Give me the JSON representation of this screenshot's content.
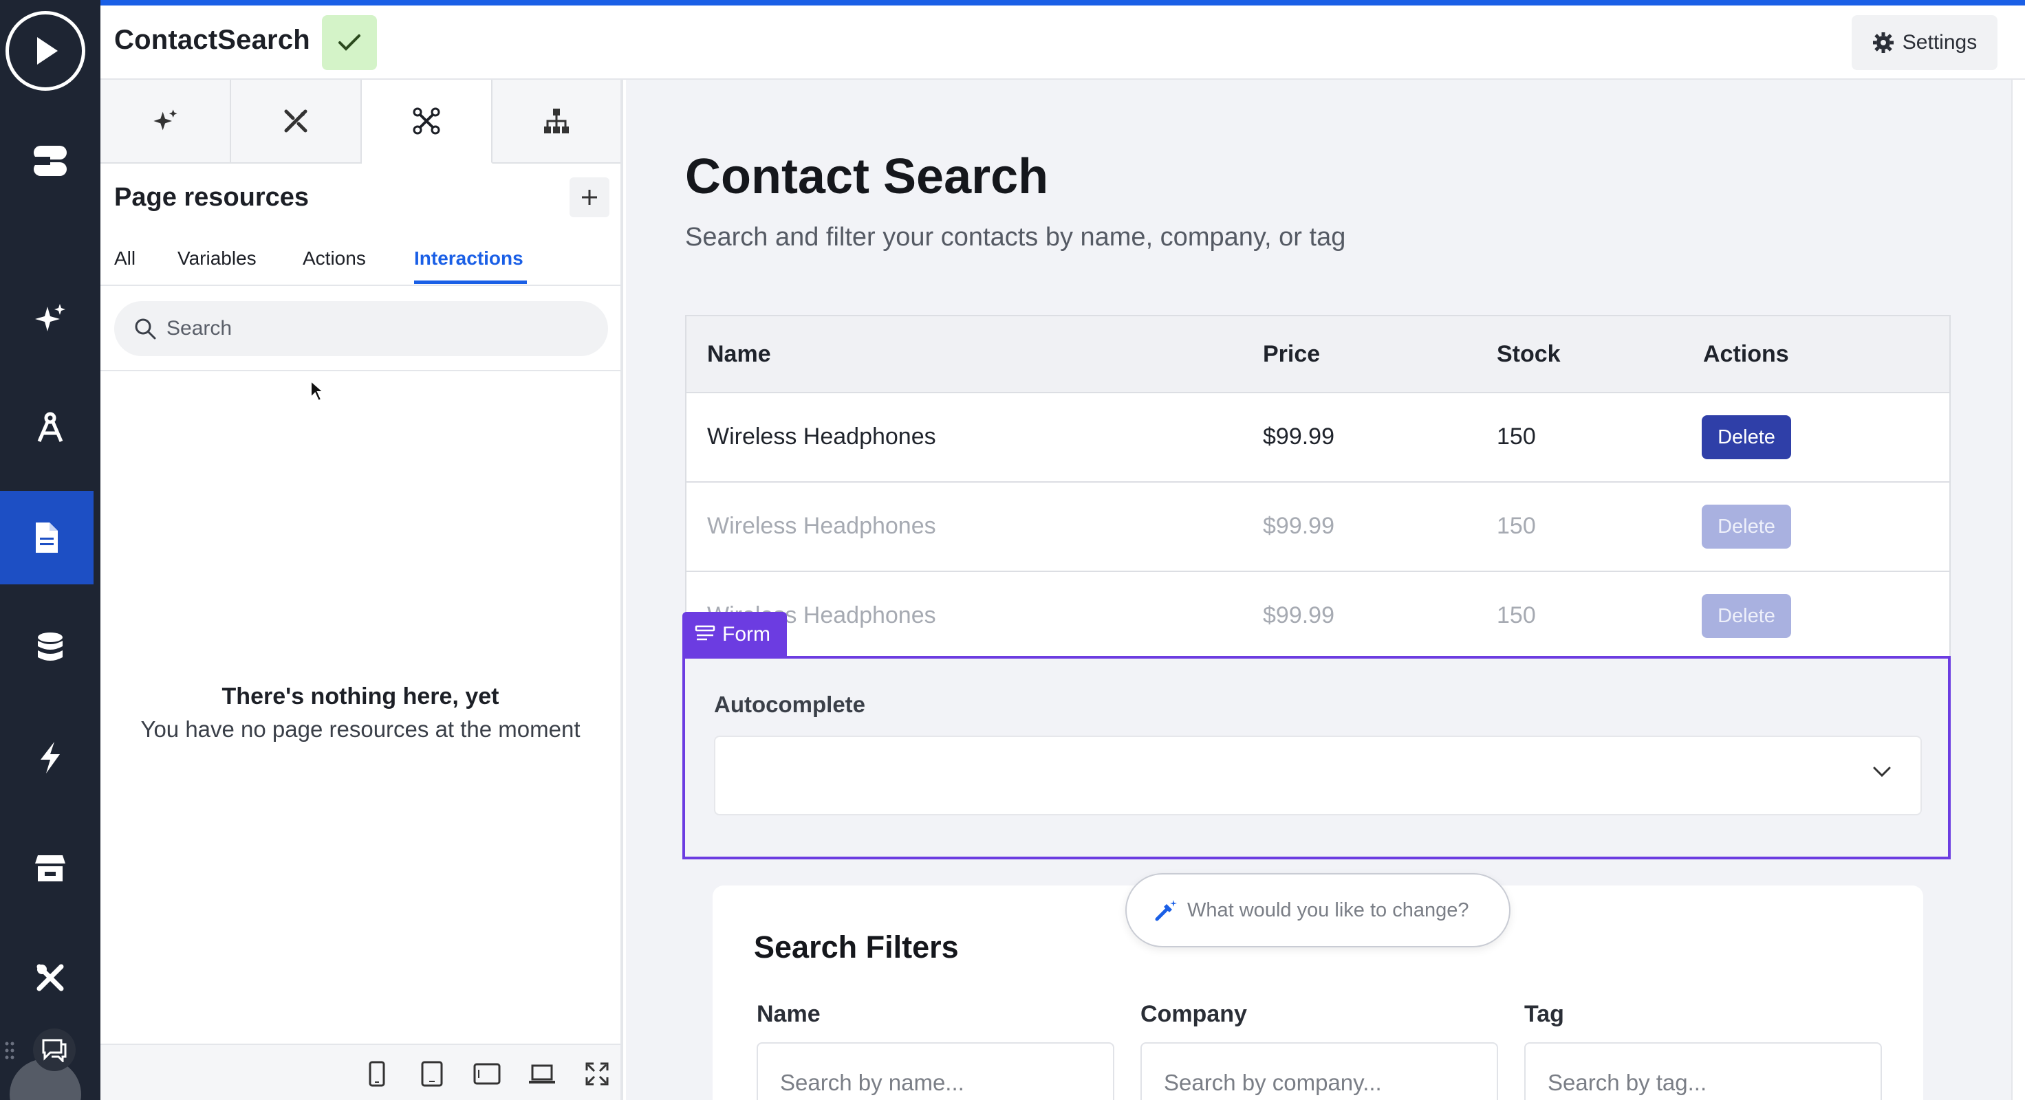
{
  "app": {
    "title": "ContactSearch",
    "settings_label": "Settings"
  },
  "colors": {
    "accent": "#1a5fe6",
    "rail_bg": "#1e2533",
    "rail_active": "#1d4fc4",
    "form_outline": "#6c3ce1",
    "delete_btn": "#2f3fa8",
    "status_green": "#d4f3c8"
  },
  "rail": {
    "items": [
      "play-icon",
      "storage-icon",
      "sparkle-icon",
      "compass-icon",
      "page-icon",
      "database-icon",
      "bolt-icon",
      "store-icon",
      "tools-icon",
      "chat-icon"
    ],
    "active": "page-icon"
  },
  "panel": {
    "tabs": [
      "sparkle-icon",
      "magic-tools-icon",
      "interactions-icon",
      "sitemap-icon"
    ],
    "active_tab": "interactions-icon",
    "title": "Page resources",
    "filter_tabs": [
      "All",
      "Variables",
      "Actions",
      "Interactions"
    ],
    "active_filter": "Interactions",
    "search_placeholder": "Search",
    "empty_title": "There's nothing here, yet",
    "empty_subtitle": "You have no page resources at the moment",
    "device_icons": [
      "phone-icon",
      "tablet-icon",
      "tablet-landscape-icon",
      "laptop-icon",
      "fullscreen-icon"
    ]
  },
  "page": {
    "heading": "Contact Search",
    "subheading": "Search and filter your contacts by name, company, or tag",
    "table": {
      "columns": [
        "Name",
        "Price",
        "Stock",
        "Actions"
      ],
      "rows": [
        {
          "name": "Wireless Headphones",
          "price": "$99.99",
          "stock": "150",
          "action": "Delete",
          "dimmed": false
        },
        {
          "name": "Wireless Headphones",
          "price": "$99.99",
          "stock": "150",
          "action": "Delete",
          "dimmed": true
        },
        {
          "name": "Wireless Headphones",
          "price": "$99.99",
          "stock": "150",
          "action": "Delete",
          "dimmed": true
        }
      ]
    },
    "form_tag": "Form",
    "autocomplete_label": "Autocomplete",
    "ai_prompt_placeholder": "What would you like to change?",
    "filters": {
      "title": "Search Filters",
      "fields": [
        {
          "label": "Name",
          "placeholder": "Search by name..."
        },
        {
          "label": "Company",
          "placeholder": "Search by company..."
        },
        {
          "label": "Tag",
          "placeholder": "Search by tag..."
        }
      ]
    }
  }
}
